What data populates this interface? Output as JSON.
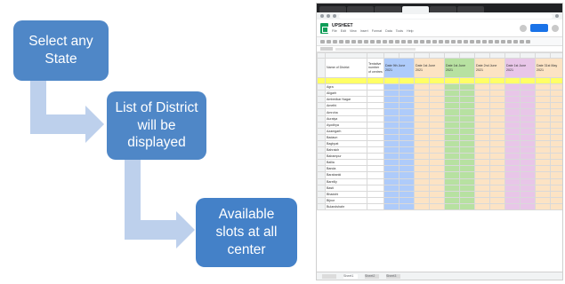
{
  "flow": {
    "steps": [
      {
        "text": "Select any State"
      },
      {
        "text": "List of District will be displayed"
      },
      {
        "text": "Available slots at all center"
      }
    ],
    "colors": {
      "box": "#4f87c7",
      "arrow": "#bdd0ec"
    }
  },
  "sheet": {
    "title": "UPSHEET",
    "menu": [
      "File",
      "Edit",
      "View",
      "Insert",
      "Format",
      "Data",
      "Tools",
      "Help"
    ],
    "header": {
      "district": "Name of District",
      "total": "Tentative number of centres",
      "dates": [
        "Date 9th June 2021",
        "Date 1st June 2021",
        "Date 1st June 2021",
        "Date 2nd June 2021",
        "Date 1st June 2021",
        "Date 31st May 2021"
      ]
    },
    "districts": [
      "Agra",
      "Aligarh",
      "Ambedkar Nagar",
      "Amethi",
      "Amroha",
      "Auraiya",
      "Ayodhya",
      "Azamgarh",
      "Badaun",
      "Baghpat",
      "Bahraich",
      "Balrampur",
      "Ballia",
      "Banda",
      "Barabanki",
      "Bareilly",
      "Basti",
      "Bhadohi",
      "Bijnor",
      "Bulandshahr"
    ],
    "sheet_tabs": [
      "Sheet1",
      "Sheet2",
      "Sheet3"
    ],
    "colors": {
      "blue": "#aecbfa",
      "orange": "#fce3c4",
      "green": "#b7e1a1",
      "purple": "#e8c6e8",
      "yellow": "#ffff66"
    }
  }
}
